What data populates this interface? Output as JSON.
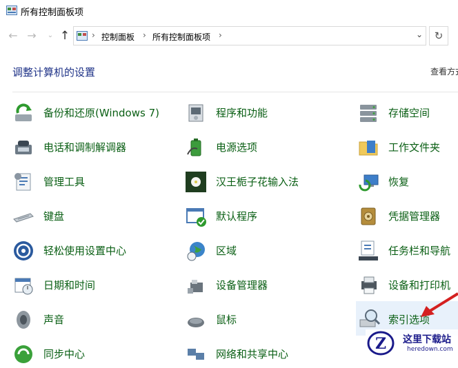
{
  "window": {
    "title": "所有控制面板项"
  },
  "address": {
    "crumbs": [
      "控制面板",
      "所有控制面板项"
    ]
  },
  "header": {
    "title": "调整计算机的设置",
    "view_by": "查看方式"
  },
  "items": [
    {
      "label": "备份和还原(Windows 7)",
      "icon": "backup-restore-icon"
    },
    {
      "label": "程序和功能",
      "icon": "programs-features-icon"
    },
    {
      "label": "存储空间",
      "icon": "storage-spaces-icon"
    },
    {
      "label": "电话和调制解调器",
      "icon": "phone-modem-icon"
    },
    {
      "label": "电源选项",
      "icon": "power-options-icon"
    },
    {
      "label": "工作文件夹",
      "icon": "work-folders-icon"
    },
    {
      "label": "管理工具",
      "icon": "admin-tools-icon"
    },
    {
      "label": "汉王栀子花输入法",
      "icon": "hanwang-ime-icon"
    },
    {
      "label": "恢复",
      "icon": "recovery-icon"
    },
    {
      "label": "键盘",
      "icon": "keyboard-icon"
    },
    {
      "label": "默认程序",
      "icon": "default-programs-icon"
    },
    {
      "label": "凭据管理器",
      "icon": "credential-manager-icon"
    },
    {
      "label": "轻松使用设置中心",
      "icon": "ease-of-access-icon"
    },
    {
      "label": "区域",
      "icon": "region-icon"
    },
    {
      "label": "任务栏和导航",
      "icon": "taskbar-navigation-icon"
    },
    {
      "label": "日期和时间",
      "icon": "date-time-icon"
    },
    {
      "label": "设备管理器",
      "icon": "device-manager-icon"
    },
    {
      "label": "设备和打印机",
      "icon": "devices-printers-icon"
    },
    {
      "label": "声音",
      "icon": "sound-icon"
    },
    {
      "label": "鼠标",
      "icon": "mouse-icon"
    },
    {
      "label": "索引选项",
      "icon": "indexing-options-icon"
    },
    {
      "label": "同步中心",
      "icon": "sync-center-icon"
    },
    {
      "label": "网络和共享中心",
      "icon": "network-sharing-icon"
    }
  ],
  "watermark": {
    "text": "这里下载站",
    "url": "heredown.com"
  },
  "colors": {
    "link": "#0a5f14",
    "heading": "#1e3287",
    "highlight": "#e8f1fb"
  }
}
